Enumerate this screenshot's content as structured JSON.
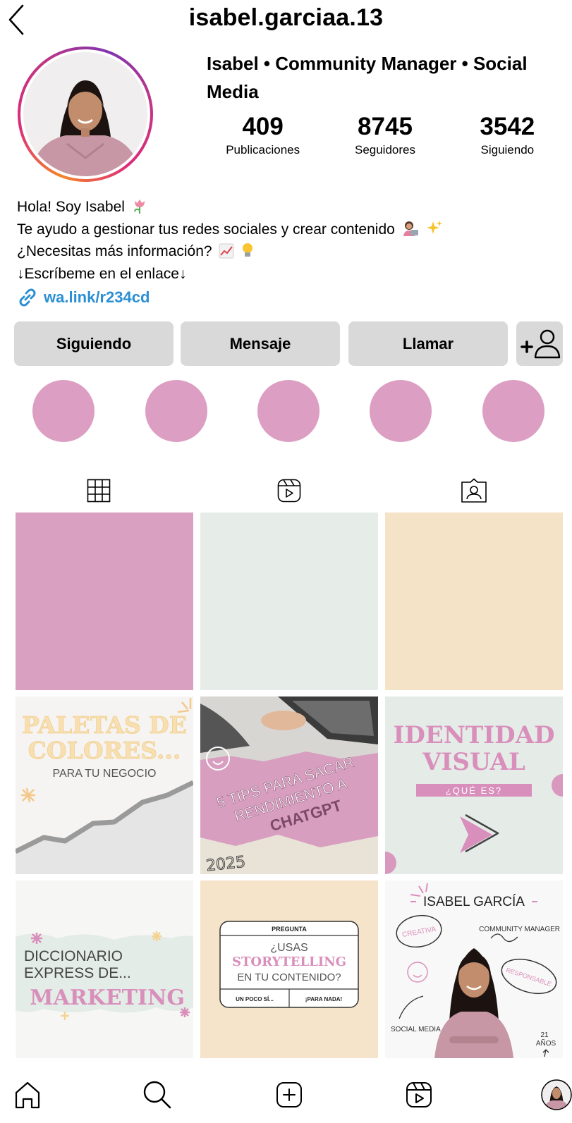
{
  "header": {
    "username": "isabel.garciaa.13",
    "back_icon": "chevron-left-icon"
  },
  "profile": {
    "display_name": "Isabel • Community Manager • Social Media",
    "stats": [
      {
        "value": "409",
        "label": "Publicaciones"
      },
      {
        "value": "8745",
        "label": "Seguidores"
      },
      {
        "value": "3542",
        "label": "Siguiendo"
      }
    ],
    "bio": {
      "line1": "Hola! Soy Isabel",
      "line2": "Te ayudo a gestionar tus redes sociales y crear contenido",
      "line3": "¿Necesitas más información?",
      "line4": "↓Escríbeme en el enlace↓",
      "link": "wa.link/r234cd"
    },
    "ring_colors": [
      "#f58529",
      "#dd2a7b",
      "#8134af"
    ]
  },
  "actions": {
    "following_label": "Siguiendo",
    "message_label": "Mensaje",
    "call_label": "Llamar",
    "add_user_icon": "add-person-icon"
  },
  "highlights": {
    "count": 5,
    "color": "#dc9ec2"
  },
  "tabs": [
    {
      "icon": "grid-icon"
    },
    {
      "icon": "reels-icon"
    },
    {
      "icon": "tagged-icon"
    }
  ],
  "posts": {
    "tile1": {
      "color": "#d9a0c1"
    },
    "tile2": {
      "color": "#e6ede9"
    },
    "tile3": {
      "color": "#f5e3c8"
    },
    "paletas": {
      "title1": "PALETAS DE",
      "title2": "COLORES...",
      "subtitle": "PARA TU NEGOCIO"
    },
    "tips": {
      "line1": "5 TIPS PARA SACAR",
      "line2": "RENDIMIENTO A",
      "line3": "CHATGPT",
      "year": "2025"
    },
    "identidad": {
      "title1": "IDENTIDAD",
      "title2": "VISUAL",
      "subtitle": "¿QUÉ ES?"
    },
    "diccionario": {
      "line1": "DICCIONARIO",
      "line2": "EXPRESS DE...",
      "line3": "MARKETING"
    },
    "pregunta": {
      "header": "PREGUNTA",
      "line1": "¿USAS",
      "line2": "STORYTELLING",
      "line3": "EN TU CONTENIDO?",
      "option1": "UN POCO SÍ...",
      "option2": "¡PARA NADA!"
    },
    "isabel": {
      "name": "ISABEL GARCÍA",
      "tag1": "CREATIVA",
      "tag2": "COMMUNITY MANAGER",
      "tag3": "RESPONSABLE",
      "tag4": "SOCIAL MEDIA",
      "age": "21",
      "age_unit": "AÑOS"
    }
  },
  "nav": [
    {
      "icon": "home-icon"
    },
    {
      "icon": "search-icon"
    },
    {
      "icon": "create-post-icon"
    },
    {
      "icon": "reels-icon"
    },
    {
      "icon": "profile-avatar"
    }
  ],
  "colors": {
    "accent_pink": "#dc9ec2",
    "link_blue": "#2a8fd4",
    "button_gray": "#d9d9d9"
  }
}
